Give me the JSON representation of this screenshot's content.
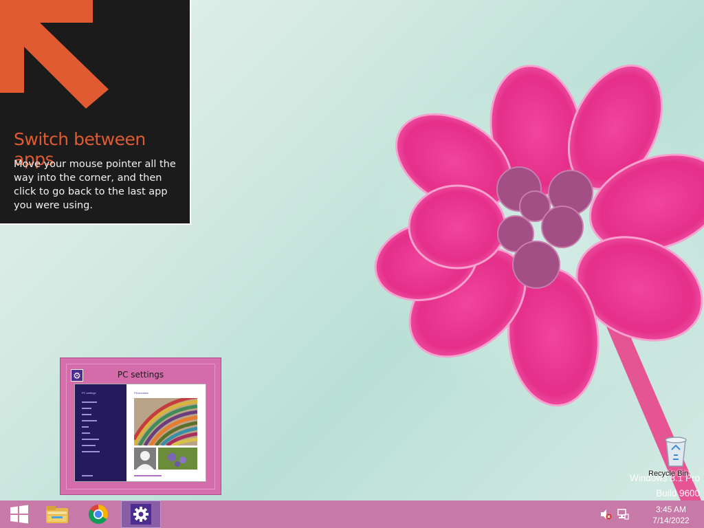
{
  "tip": {
    "title": "Switch between apps",
    "body": "Move your mouse pointer all the way into the corner, and then click to go back to the last app you were using.",
    "accent_color": "#e05a32"
  },
  "thumbnail": {
    "title": "PC settings",
    "preview": {
      "side_header": "PC settings",
      "main_header": "Personalize"
    }
  },
  "desktop": {
    "recycle_bin_label": "Recycle Bin",
    "watermark_line1": "Windows 8.1 Pro",
    "watermark_line2": "Build 9600"
  },
  "taskbar": {
    "start_icon": "windows-logo-icon",
    "apps": [
      {
        "name": "file-explorer-icon"
      },
      {
        "name": "chrome-icon"
      },
      {
        "name": "pc-settings-icon",
        "active": true
      }
    ],
    "tray": {
      "volume_icon": "volume-muted-icon",
      "network_icon": "network-icon"
    },
    "clock": {
      "time": "3:45 AM",
      "date": "7/14/2022"
    },
    "color": "#c779a7"
  }
}
